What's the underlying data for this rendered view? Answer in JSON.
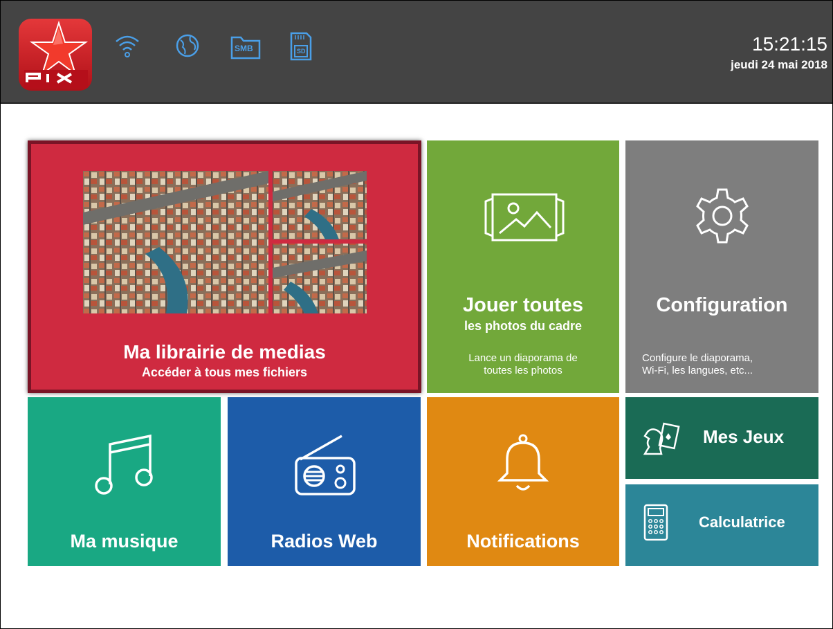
{
  "app": {
    "logo_text": "PIX"
  },
  "status_bar": {
    "icons": [
      "wifi-icon",
      "globe-icon",
      "smb-folder-icon",
      "sd-card-icon"
    ],
    "smb_label": "SMB",
    "sd_label": "SD",
    "time": "15:21:15",
    "date": "jeudi 24 mai 2018"
  },
  "tiles": {
    "library": {
      "title": "Ma librairie de medias",
      "subtitle": "Accéder à tous mes fichiers",
      "color": "#cf2a40"
    },
    "play_all": {
      "title": "Jouer toutes",
      "subtitle": "les photos du cadre",
      "desc_line1": "Lance un diaporama de",
      "desc_line2": "toutes les photos",
      "color": "#72a83a"
    },
    "configuration": {
      "title": "Configuration",
      "desc_line1": "Configure le diaporama,",
      "desc_line2": "Wi-Fi, les langues, etc...",
      "color": "#7e7e7e"
    },
    "music": {
      "title": "Ma musique",
      "color": "#19a883"
    },
    "radio": {
      "title": "Radios Web",
      "color": "#1d5ca9"
    },
    "notifications": {
      "title": "Notifications",
      "color": "#e08912"
    },
    "games": {
      "title": "Mes Jeux",
      "color": "#1a6b55"
    },
    "calculator": {
      "title": "Calculatrice",
      "color": "#2c8698"
    }
  }
}
